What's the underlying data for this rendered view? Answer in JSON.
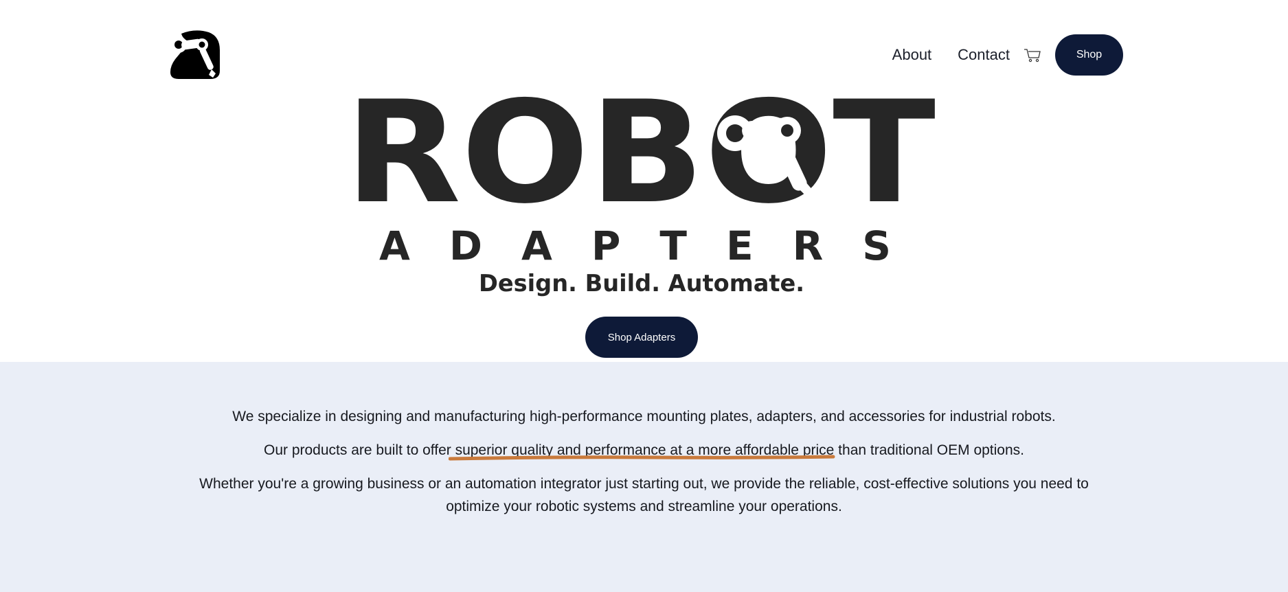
{
  "brand": {
    "wordmark_main": "ROBOT",
    "wordmark_sub": "ADAPTERS",
    "tagline": "Design. Build. Automate.",
    "text_color": "#262626",
    "logo_icon": "robot-arm-icon"
  },
  "nav": {
    "about": "About",
    "contact": "Contact",
    "cart_icon": "cart-icon",
    "shop": "Shop"
  },
  "hero": {
    "cta": "Shop Adapters"
  },
  "info": {
    "p1": "We specialize in designing and manufacturing high-performance mounting plates, adapters, and accessories for industrial robots.",
    "p2_before": "Our products are built to offer ",
    "p2_highlight": "superior quality and performance at a more affordable price",
    "p2_after": " than traditional OEM options.",
    "p3": "Whether you're a growing business or an automation integrator just starting out, we provide the reliable, cost-effective solutions you need to optimize your robotic systems and streamline your operations."
  },
  "colors": {
    "button_bg": "#0e1a38",
    "section_bg": "#eaeef7",
    "highlight_underline": "#c97a3c"
  }
}
